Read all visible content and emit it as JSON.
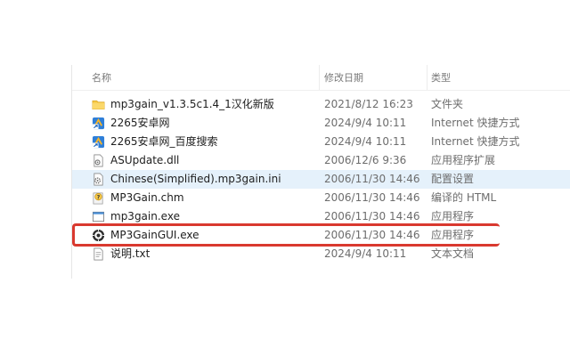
{
  "columns": {
    "name": "名称",
    "date": "修改日期",
    "type": "类型"
  },
  "files": [
    {
      "name": "mp3gain_v1.3.5c1.4_1汉化新版",
      "date": "2021/8/12 16:23",
      "type": "文件夹",
      "icon": "folder-icon"
    },
    {
      "name": "2265安卓网",
      "date": "2024/9/4 10:11",
      "type": "Internet 快捷方式",
      "icon": "internet-shortcut-icon"
    },
    {
      "name": "2265安卓网_百度搜索",
      "date": "2024/9/4 10:11",
      "type": "Internet 快捷方式",
      "icon": "internet-shortcut-icon"
    },
    {
      "name": "ASUpdate.dll",
      "date": "2006/12/6 9:36",
      "type": "应用程序扩展",
      "icon": "dll-icon"
    },
    {
      "name": "Chinese(Simplified).mp3gain.ini",
      "date": "2006/11/30 14:46",
      "type": "配置设置",
      "icon": "ini-icon"
    },
    {
      "name": "MP3Gain.chm",
      "date": "2006/11/30 14:46",
      "type": "编译的 HTML",
      "icon": "chm-icon"
    },
    {
      "name": "mp3gain.exe",
      "date": "2006/11/30 14:46",
      "type": "应用程序",
      "icon": "exe-icon"
    },
    {
      "name": "MP3GainGUI.exe",
      "date": "2006/11/30 14:46",
      "type": "应用程序",
      "icon": "mp3gain-app-icon"
    },
    {
      "name": "说明.txt",
      "date": "2024/9/4 10:11",
      "type": "文本文档",
      "icon": "text-file-icon"
    }
  ],
  "selected_index": 4,
  "highlighted_index": 7,
  "colors": {
    "selection": "#e5f1fb",
    "highlight_box": "#d9392f",
    "folder": "#f7c948"
  }
}
